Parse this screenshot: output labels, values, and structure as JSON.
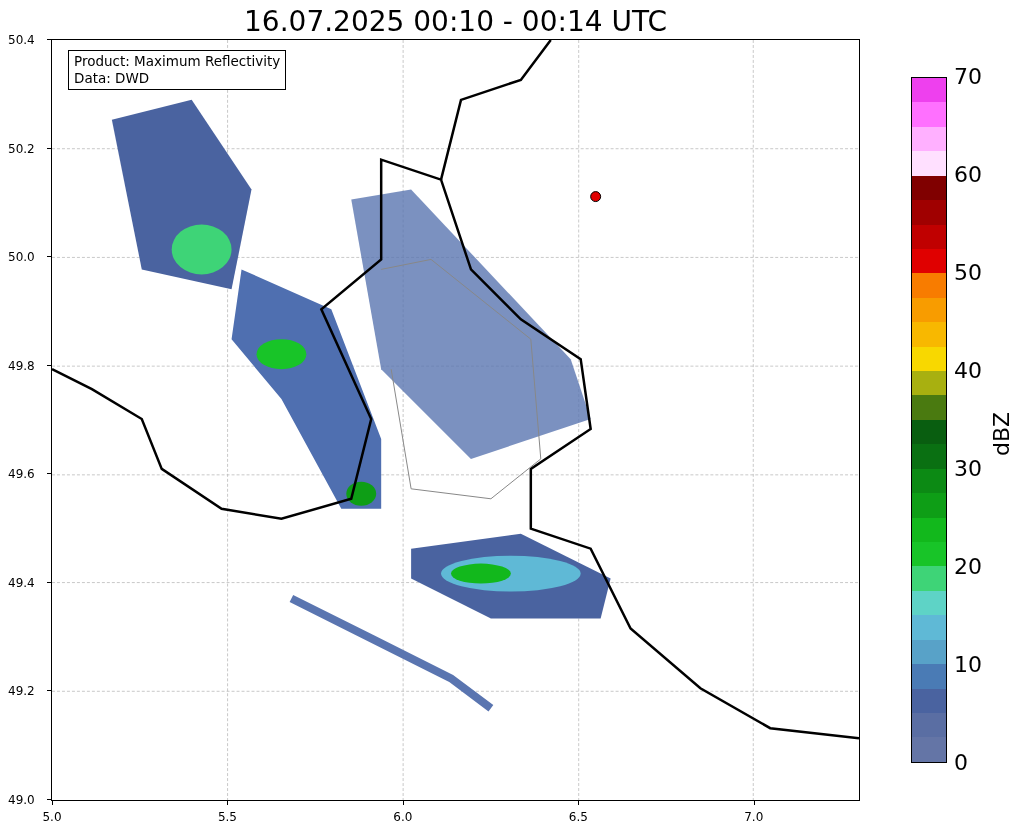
{
  "title": "16.07.2025 00:10 - 00:14 UTC",
  "info_box": [
    "Product: Maximum Reflectivity",
    "Data: DWD"
  ],
  "x_ticks": [
    "5.0",
    "5.5",
    "6.0",
    "6.5",
    "7.0"
  ],
  "y_ticks": [
    "50.4",
    "50.2",
    "50.0",
    "49.8",
    "49.6",
    "49.4",
    "49.2",
    "49.0"
  ],
  "colorbar": {
    "label": "dBZ",
    "ticks": [
      "70",
      "60",
      "50",
      "40",
      "30",
      "20",
      "10",
      "0"
    ],
    "segments": [
      {
        "color": "#ee40ee"
      },
      {
        "color": "#ff70ff"
      },
      {
        "color": "#ffb0ff"
      },
      {
        "color": "#ffe0ff"
      },
      {
        "color": "#800000"
      },
      {
        "color": "#a00000"
      },
      {
        "color": "#c00000"
      },
      {
        "color": "#e00000"
      },
      {
        "color": "#f87c00"
      },
      {
        "color": "#f89c00"
      },
      {
        "color": "#f8b800"
      },
      {
        "color": "#f8d800"
      },
      {
        "color": "#a8b010"
      },
      {
        "color": "#4a7a10"
      },
      {
        "color": "#095e10"
      },
      {
        "color": "#0a7012"
      },
      {
        "color": "#0c8a14"
      },
      {
        "color": "#0e9e16"
      },
      {
        "color": "#12b81c"
      },
      {
        "color": "#18c428"
      },
      {
        "color": "#3ed477"
      },
      {
        "color": "#5ed3c6"
      },
      {
        "color": "#5fb9d6"
      },
      {
        "color": "#58a2c8"
      },
      {
        "color": "#4a7bb5"
      },
      {
        "color": "#4a63a0"
      },
      {
        "color": "#5a6ea3"
      },
      {
        "color": "#6475a6"
      }
    ]
  }
}
